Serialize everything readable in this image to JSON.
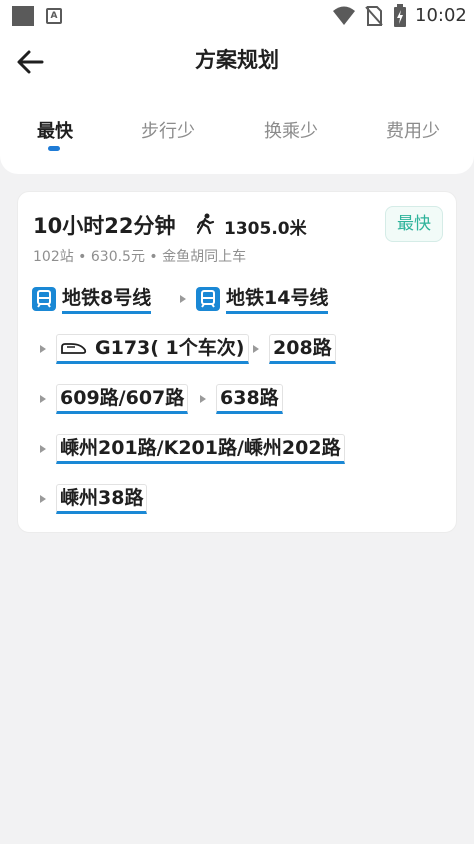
{
  "status_bar": {
    "time": "10:02",
    "icons": [
      "app-square-icon",
      "a-icon",
      "wifi-icon",
      "no-sim-icon",
      "battery-icon"
    ]
  },
  "header": {
    "title": "方案规划",
    "back_icon": "back-arrow-icon"
  },
  "tabs": [
    {
      "label": "最快",
      "active": true
    },
    {
      "label": "步行少",
      "active": false
    },
    {
      "label": "换乘少",
      "active": false
    },
    {
      "label": "费用少",
      "active": false
    }
  ],
  "route": {
    "duration": "10小时22分钟",
    "walk_distance": "1305.0米",
    "badge": "最快",
    "summary": "102站 • 630.5元 • 金鱼胡同上车",
    "segments": {
      "subway1": "地铁8号线",
      "subway2": "地铁14号线",
      "train": "G173( 1个车次)",
      "bus1": "208路",
      "bus2": "609路/607路",
      "bus3": "638路",
      "bus4": "嵊州201路/K201路/嵊州202路",
      "bus5": "嵊州38路"
    }
  },
  "colors": {
    "accent_blue": "#1a88d5",
    "badge_green": "#2fb39b",
    "background": "#f2f2f3"
  }
}
